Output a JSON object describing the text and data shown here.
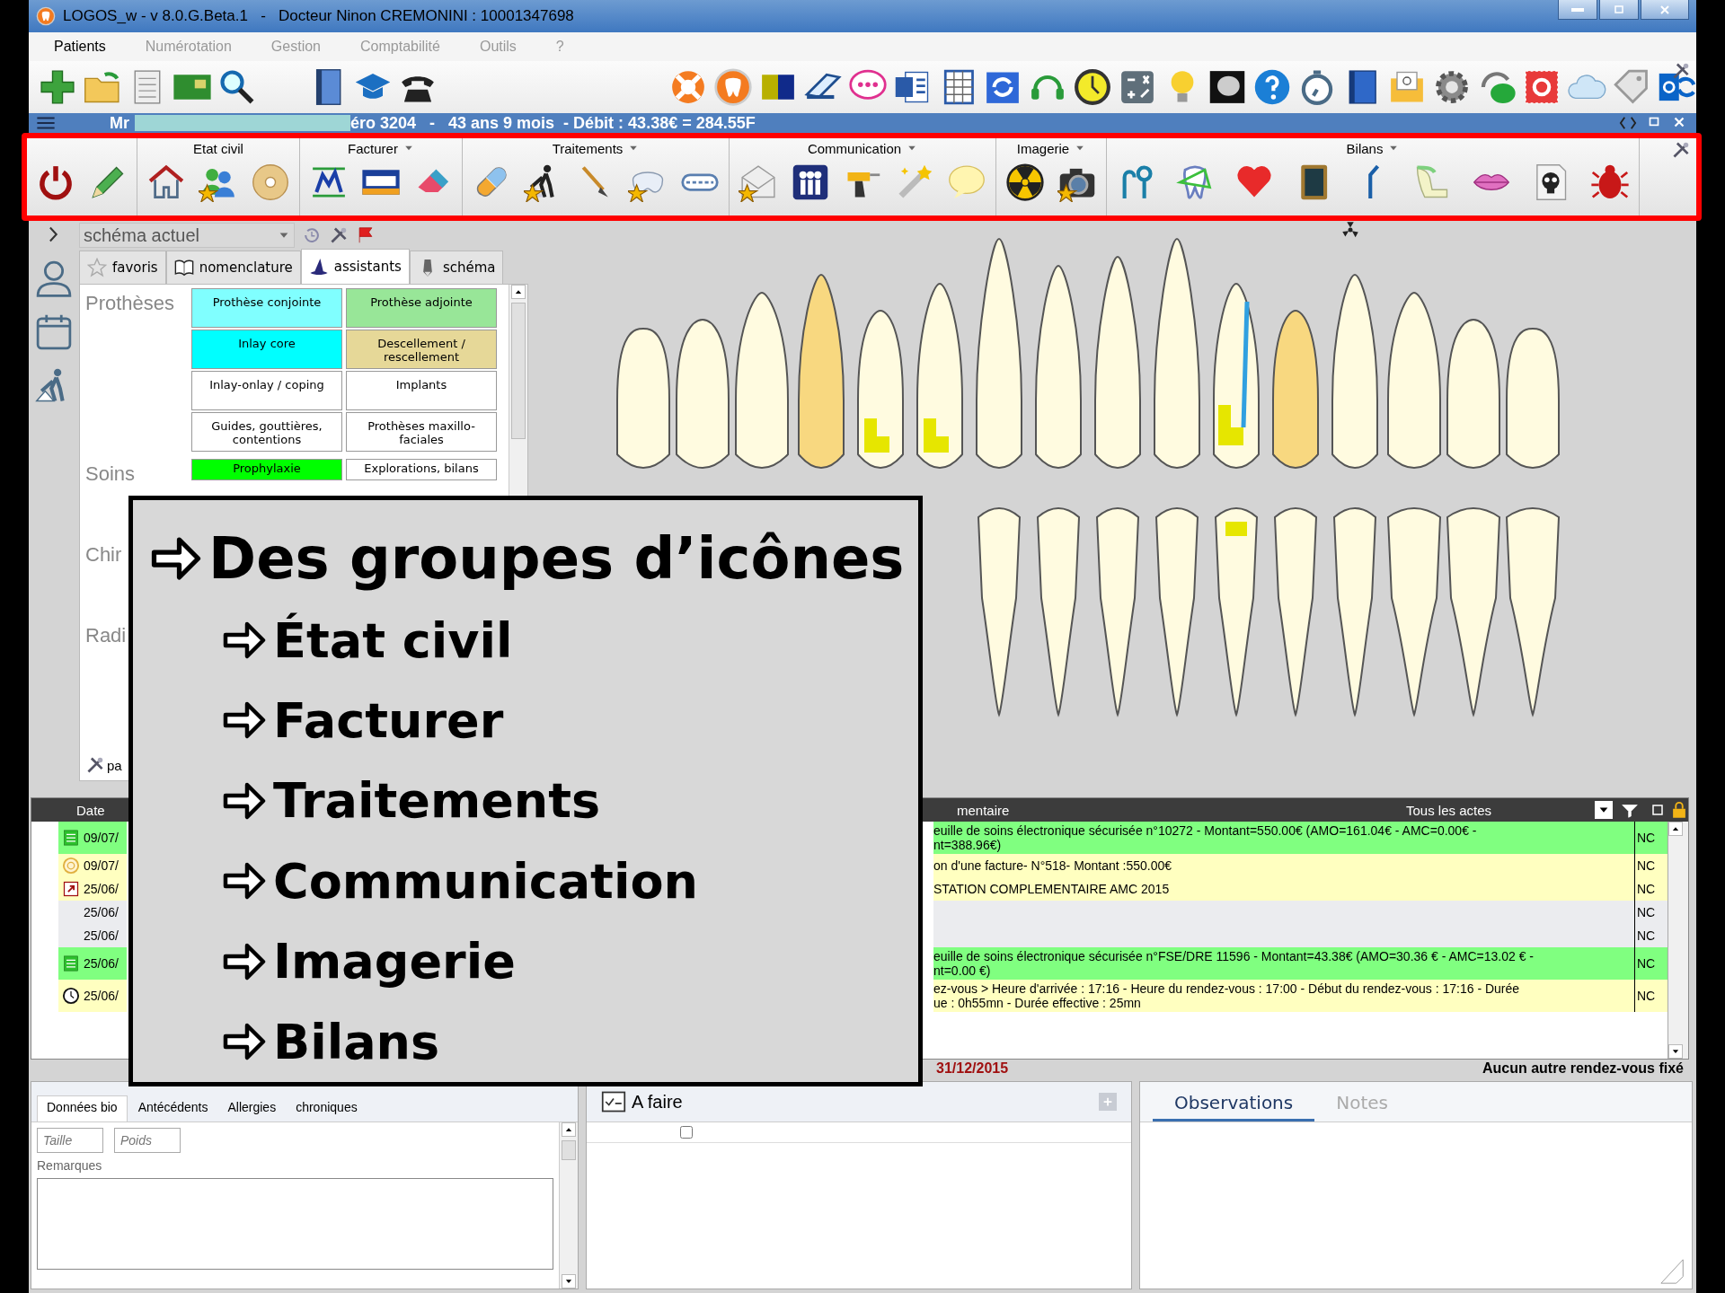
{
  "window": {
    "title": "LOGOS_w - v 8.0.G.Beta.1   -   Docteur Ninon CREMONINI : 10001347698"
  },
  "menu": [
    {
      "label": "Patients",
      "disabled": false
    },
    {
      "label": "Numérotation",
      "disabled": true
    },
    {
      "label": "Gestion",
      "disabled": true
    },
    {
      "label": "Comptabilité",
      "disabled": true
    },
    {
      "label": "Outils",
      "disabled": true
    },
    {
      "label": "?",
      "disabled": true
    }
  ],
  "patient_bar": {
    "prefix": "Mr",
    "text": "éro 3204   -   43 ans 9 mois  - Débit : 43.38€ = 284.55F"
  },
  "ribbon": {
    "groups": [
      {
        "has_menu": false
      },
      {
        "label": "Etat civil",
        "has_menu": false
      },
      {
        "label": "Facturer",
        "has_menu": true
      },
      {
        "label": "Traitements",
        "has_menu": true
      },
      {
        "label": "Communication",
        "has_menu": true
      },
      {
        "label": "Imagerie",
        "has_menu": true
      },
      {
        "label": "Bilans",
        "has_menu": true
      }
    ]
  },
  "schema_select": {
    "value": "schéma actuel"
  },
  "panel_tabs": [
    {
      "label": "favoris",
      "selected": false
    },
    {
      "label": "nomenclature",
      "selected": false
    },
    {
      "label": "assistants",
      "selected": true
    },
    {
      "label": "schéma",
      "selected": false
    }
  ],
  "assistant_sections": [
    {
      "title": "Prothèses",
      "buttons": [
        {
          "label": "Prothèse conjointe",
          "color": "#80ffff"
        },
        {
          "label": "Prothèse adjointe",
          "color": "#98e698"
        },
        {
          "label": "Inlay core",
          "color": "#00ffff"
        },
        {
          "label": "Descellement / rescellement",
          "color": "#e6d898"
        },
        {
          "label": "Inlay-onlay / coping",
          "color": "#ffffff"
        },
        {
          "label": "Implants",
          "color": "#ffffff"
        },
        {
          "label": "Guides, gouttières, contentions",
          "color": "#ffffff"
        },
        {
          "label": "Prothèses maxillo-faciales",
          "color": "#ffffff"
        }
      ]
    },
    {
      "title": "Soins",
      "buttons": [
        {
          "label": "Prophylaxie",
          "color": "#00ff00"
        },
        {
          "label": "Explorations, bilans",
          "color": "#ffffff"
        }
      ]
    },
    {
      "title": "Chir"
    },
    {
      "title": "Radi"
    }
  ],
  "panel_footer": "pa",
  "history": {
    "columns": [
      "Date",
      "mentaire"
    ],
    "filter": "Tous les actes",
    "rows": [
      {
        "kind": "fse",
        "color": "#80ff80",
        "date": "09/07/",
        "comment_lines": [
          "euille de soins électronique sécurisée n°10272 - Montant=550.00€ (AMO=161.04€ - AMC=0.00€ -",
          "nt=388.96€)"
        ],
        "status": "NC"
      },
      {
        "kind": "invoice",
        "color": "#ffffc0",
        "date": "09/07/",
        "comment_lines": [
          "on d'une facture- N°518- Montant :550.00€"
        ],
        "status": "NC"
      },
      {
        "kind": "complement",
        "color": "#ffffc0",
        "date": "25/06/",
        "comment_lines": [
          "STATION COMPLEMENTAIRE AMC 2015"
        ],
        "status": "NC"
      },
      {
        "kind": "none",
        "color": "#ebecef",
        "date": "25/06/",
        "comment_lines": [],
        "status": "NC"
      },
      {
        "kind": "none",
        "color": "#ebecef",
        "date": "25/06/",
        "comment_lines": [],
        "status": "NC"
      },
      {
        "kind": "fse",
        "color": "#80ff80",
        "date": "25/06/",
        "comment_lines": [
          "euille de soins électronique sécurisée n°FSE/DRE 11596 - Montant=43.38€ (AMO=30.36 € - AMC=13.02 € -",
          "nt=0.00 €)"
        ],
        "status": "NC"
      },
      {
        "kind": "appointment",
        "color": "#ffffc0",
        "date": "25/06/",
        "comment_lines": [
          "ez-vous > Heure d'arrivée : 17:16 - Heure du rendez-vous : 17:00 - Début du rendez-vous : 17:16 - Durée",
          "ue : 0h55mn - Durée effective : 25mn"
        ],
        "status": "NC"
      }
    ]
  },
  "status": {
    "date": "31/12/2015",
    "next_appointment": "Aucun autre rendez-vous fixé"
  },
  "bottom_left": {
    "tabs": [
      {
        "label": "Données bio",
        "selected": true
      },
      {
        "label": "Antécédents",
        "selected": false
      },
      {
        "label": "Allergies",
        "selected": false
      },
      {
        "label": "chroniques",
        "selected": false
      }
    ],
    "fields": [
      {
        "placeholder": "Taille"
      },
      {
        "placeholder": "Poids"
      }
    ],
    "remarks_label": "Remarques"
  },
  "todo": {
    "title": "A faire",
    "rows": [
      {
        "checked": false
      }
    ]
  },
  "notes_tabs": [
    {
      "label": "Observations",
      "selected": true
    },
    {
      "label": "Notes",
      "selected": false
    }
  ],
  "callout": {
    "title": "Des groupes d’icônes",
    "items": [
      "État civil",
      "Facturer",
      "Traitements",
      "Communication",
      "Imagerie",
      "Bilans"
    ]
  }
}
